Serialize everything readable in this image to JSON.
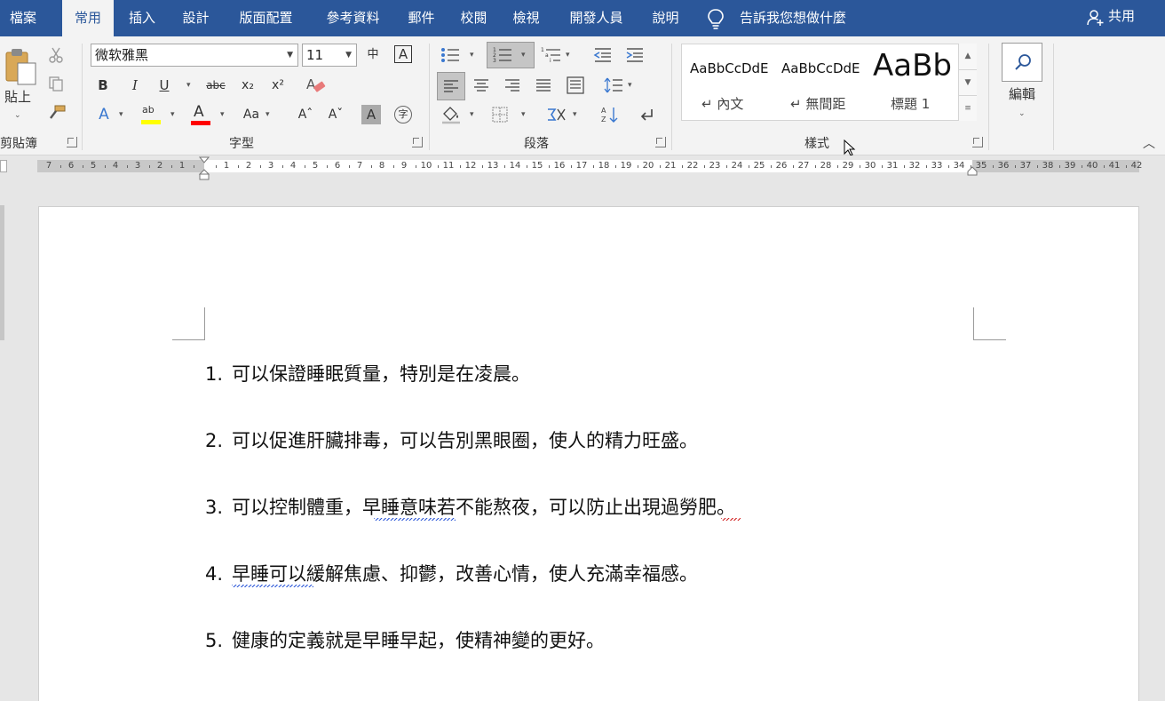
{
  "tabs": [
    "檔案",
    "常用",
    "插入",
    "設計",
    "版面配置",
    "參考資料",
    "郵件",
    "校閱",
    "檢視",
    "開發人員",
    "說明"
  ],
  "active_tab": "常用",
  "tell_me": "告訴我您想做什麼",
  "share": "共用",
  "ribbon": {
    "clipboard": {
      "label": "剪貼簿",
      "paste": "貼上"
    },
    "font": {
      "label": "字型",
      "font_name": "微软雅黑",
      "font_size": "11",
      "bold": "B",
      "italic": "I",
      "underline": "U",
      "strike": "abc",
      "subscript": "x₂",
      "superscript": "x²",
      "font_color_letter": "A",
      "change_case": "Aa",
      "grow_font": "A^",
      "shrink_font": "Aˇ",
      "shading": "A",
      "phonetic": "中",
      "highlight_letters": "ab"
    },
    "paragraph": {
      "label": "段落"
    },
    "styles": {
      "label": "樣式",
      "items": [
        {
          "sample": "AaBbCcDdE",
          "name": "↵ 內文"
        },
        {
          "sample": "AaBbCcDdE",
          "name": "↵ 無間距"
        },
        {
          "sample": "AaBb",
          "name": "標題 1"
        }
      ]
    },
    "editing": {
      "label": "編輯"
    }
  },
  "ruler": {
    "left_numbers": [
      "7",
      "6",
      "5",
      "4",
      "3",
      "2",
      "1"
    ],
    "right_numbers": [
      "1",
      "2",
      "3",
      "4",
      "5",
      "6",
      "7",
      "8",
      "9",
      "10",
      "11",
      "12",
      "13",
      "14",
      "15",
      "16",
      "17",
      "18",
      "19",
      "20",
      "21",
      "22",
      "23",
      "24",
      "25",
      "26",
      "27",
      "28",
      "29",
      "30",
      "31",
      "32",
      "33",
      "34",
      "35",
      "36",
      "37",
      "38",
      "39",
      "40",
      "41",
      "42"
    ]
  },
  "document": {
    "list": [
      {
        "num": "1.",
        "text": "可以保證睡眠質量，特別是在凌晨。"
      },
      {
        "num": "2.",
        "text": "可以促進肝臟排毒，可以告別黑眼圈，使人的精力旺盛。"
      },
      {
        "num": "3.",
        "text": "可以控制體重，早睡意味若不能熬夜，可以防止出現過勞肥。"
      },
      {
        "num": "4.",
        "text": "早睡可以緩解焦慮、抑鬱，改善心情，使人充滿幸福感。"
      },
      {
        "num": "5.",
        "text": "健康的定義就是早睡早起，使精神變的更好。"
      }
    ]
  },
  "colors": {
    "tab_bar": "#2b579a",
    "ribbon": "#f3f3f3",
    "highlight_yellow": "#ffff00",
    "font_color_red": "#ff0000"
  }
}
